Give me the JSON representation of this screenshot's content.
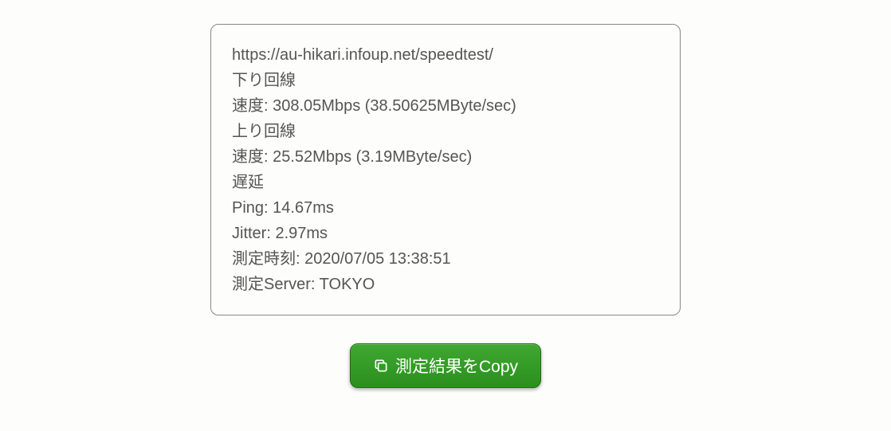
{
  "result": {
    "url": "https://au-hikari.infoup.net/speedtest/",
    "down_label": "下り回線",
    "down_speed": "速度: 308.05Mbps (38.50625MByte/sec)",
    "up_label": "上り回線",
    "up_speed": "速度: 25.52Mbps (3.19MByte/sec)",
    "latency_label": "遅延",
    "ping": "Ping: 14.67ms",
    "jitter": "Jitter: 2.97ms",
    "measured_at": "測定時刻: 2020/07/05 13:38:51",
    "server": "測定Server: TOKYO"
  },
  "button": {
    "copy_label": "測定結果をCopy"
  }
}
